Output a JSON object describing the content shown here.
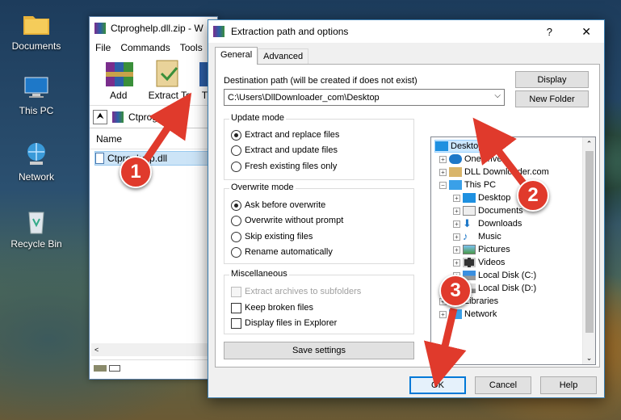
{
  "desktop": {
    "icons": [
      {
        "label": "Documents"
      },
      {
        "label": "This PC"
      },
      {
        "label": "Network"
      },
      {
        "label": "Recycle Bin"
      }
    ]
  },
  "winrar": {
    "title": "Ctproghelp.dll.zip - W",
    "menu": [
      "File",
      "Commands",
      "Tools"
    ],
    "toolbar": {
      "add": "Add",
      "extract_to": "Extract To",
      "more": "T"
    },
    "address": "Ctproghelp",
    "column_name": "Name",
    "file": "Ctproghelp.dll"
  },
  "dialog": {
    "title": "Extraction path and options",
    "help_glyph": "?",
    "close_glyph": "✕",
    "tabs": {
      "general": "General",
      "advanced": "Advanced"
    },
    "dest_label": "Destination path (will be created if does not exist)",
    "dest_value": "C:\\Users\\DllDownloader_com\\Desktop",
    "display_button": "Display",
    "new_folder_button": "New Folder",
    "update_mode": {
      "label": "Update mode",
      "options": [
        "Extract and replace files",
        "Extract and update files",
        "Fresh existing files only"
      ],
      "selected": 0
    },
    "overwrite_mode": {
      "label": "Overwrite mode",
      "options": [
        "Ask before overwrite",
        "Overwrite without prompt",
        "Skip existing files",
        "Rename automatically"
      ],
      "selected": 0
    },
    "misc": {
      "label": "Miscellaneous",
      "options": [
        "Extract archives to subfolders",
        "Keep broken files",
        "Display files in Explorer"
      ]
    },
    "save_settings": "Save settings",
    "tree": {
      "items": [
        "Desktop",
        "OneDrive",
        "DLL Downloader.com",
        "This PC",
        "Desktop",
        "Documents",
        "Downloads",
        "Music",
        "Pictures",
        "Videos",
        "Local Disk (C:)",
        "Local Disk (D:)",
        "Libraries",
        "Network"
      ]
    },
    "ok": "OK",
    "cancel": "Cancel",
    "help": "Help"
  },
  "annotations": [
    "1",
    "2",
    "3"
  ],
  "colors": {
    "badge": "#e03a2c",
    "accent": "#0078d7",
    "selection": "#cce4f7"
  }
}
